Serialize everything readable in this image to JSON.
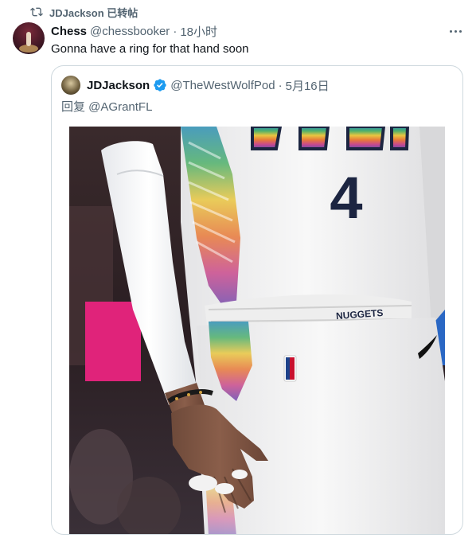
{
  "retweet": {
    "label": "JDJackson 已转帖",
    "icon": "retweet-icon"
  },
  "tweet": {
    "name": "Chess",
    "handle": "@chessbooker",
    "separator": "·",
    "time": "18小时",
    "text": "Gonna have a ring for that hand soon"
  },
  "quote": {
    "name": "JDJackson",
    "handle": "@TheWestWolfPod",
    "separator": "·",
    "time": "5月16日",
    "reply_prefix": "回复 ",
    "reply_mention": "@AGrantFL",
    "photo": {
      "jersey_number": "4",
      "waistband_text": "NUGGETS"
    }
  },
  "colors": {
    "text_primary": "#0f1419",
    "text_secondary": "#536471",
    "border": "#cfd9de",
    "verified": "#1d9bf0"
  }
}
